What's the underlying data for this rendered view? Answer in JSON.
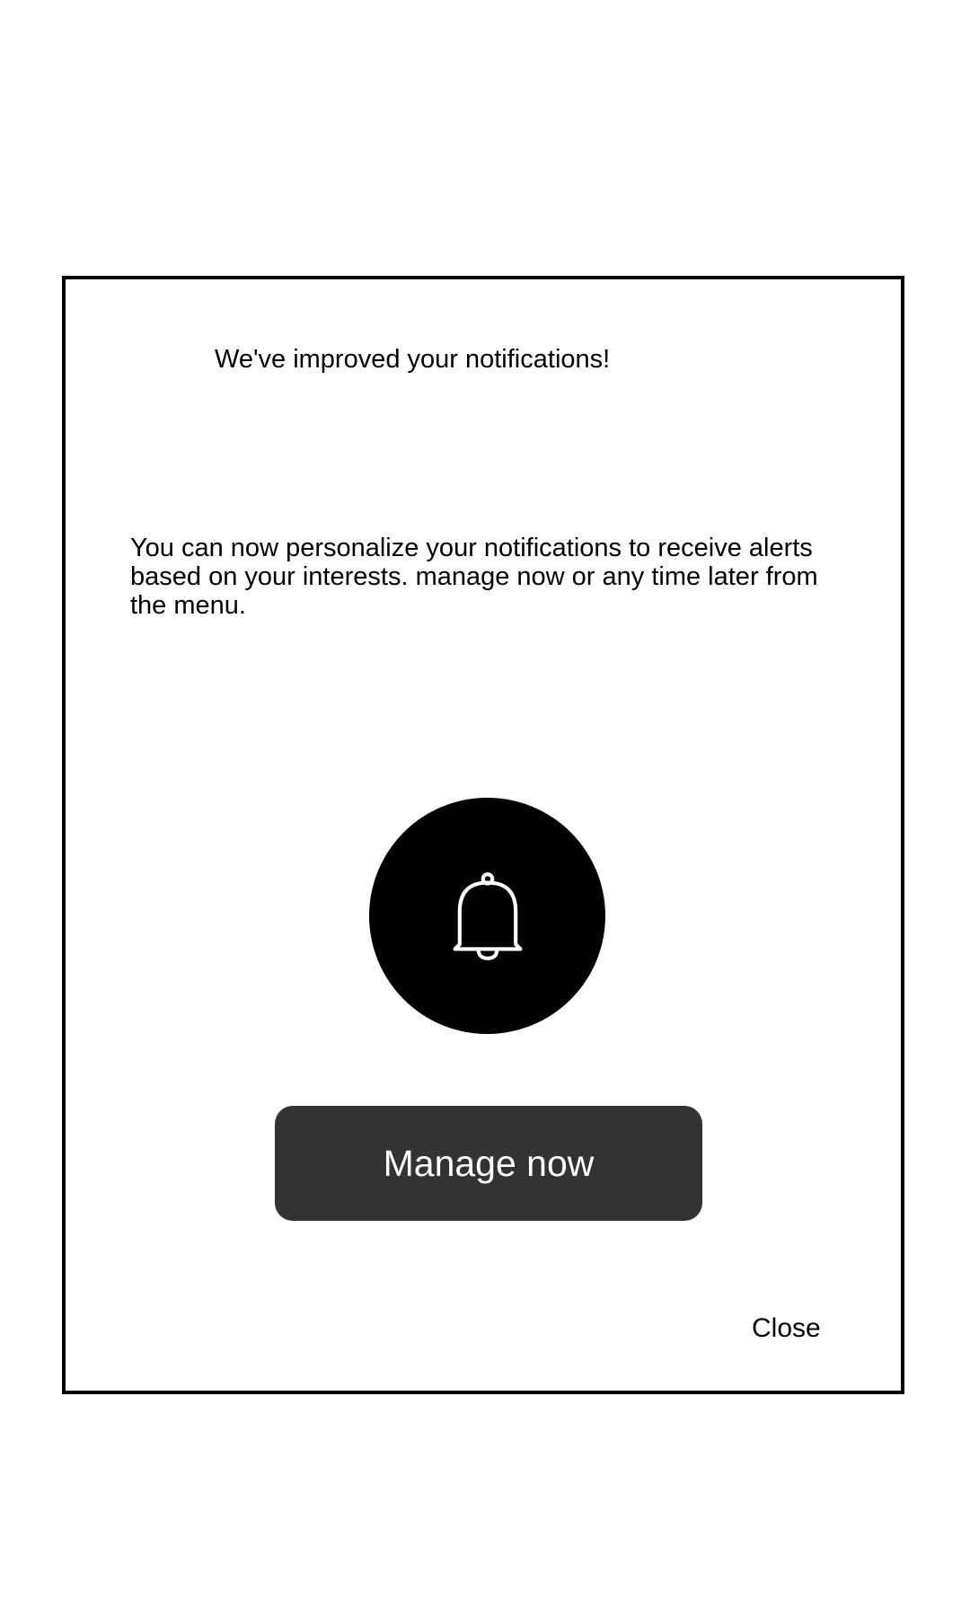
{
  "dialog": {
    "title": "We've improved your notifications!",
    "body": "You can now personalize your notifications to receive alerts based on your interests. manage now or any time later from the menu.",
    "icon": "bell-icon",
    "primary_button_label": "Manage now",
    "close_label": "Close"
  },
  "colors": {
    "background": "#ffffff",
    "border": "#000000",
    "icon_circle": "#000000",
    "primary_button": "#333333",
    "primary_button_text": "#ffffff"
  }
}
